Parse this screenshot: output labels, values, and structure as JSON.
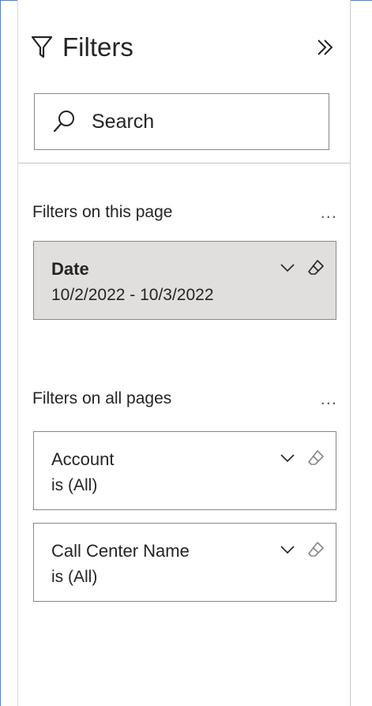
{
  "filters_pane": {
    "title": "Filters",
    "collapse_icon": "double-chevron-right-icon",
    "search": {
      "placeholder": "Search",
      "value": ""
    },
    "page_section": {
      "title": "Filters on this page",
      "more_label": "...",
      "cards": [
        {
          "name": "Date",
          "value": "10/2/2022 - 10/3/2022",
          "active": true
        }
      ]
    },
    "all_pages_section": {
      "title": "Filters on all pages",
      "more_label": "...",
      "cards": [
        {
          "name": "Account",
          "value": "is (All)",
          "active": false
        },
        {
          "name": "Call Center Name",
          "value": "is (All)",
          "active": false
        }
      ]
    }
  },
  "colors": {
    "active_card_bg": "#e1dfdd",
    "border": "#8a8886",
    "text": "#252423",
    "frame_border": "#5b7fb8"
  }
}
